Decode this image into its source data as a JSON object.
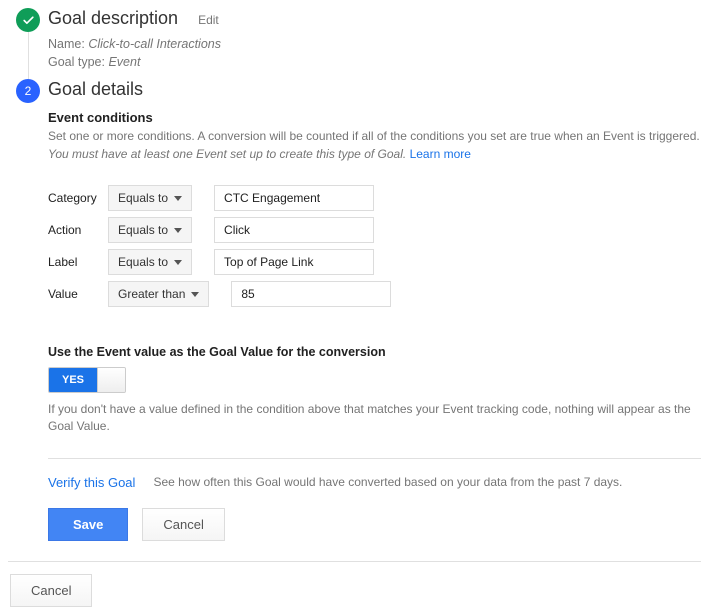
{
  "step1": {
    "title": "Goal description",
    "edit": "Edit",
    "name_label": "Name:",
    "name_value": "Click-to-call Interactions",
    "type_label": "Goal type:",
    "type_value": "Event"
  },
  "step2": {
    "title": "Goal details",
    "number": "2",
    "subheading": "Event conditions",
    "description_pre": "Set one or more conditions. A conversion will be counted if all of the conditions you set are true when an Event is triggered. ",
    "description_em": "You must have at least one Event set up to create this type of Goal.",
    "learn_more": "Learn more",
    "conditions": [
      {
        "label": "Category",
        "operator": "Equals to",
        "value": "CTC Engagement"
      },
      {
        "label": "Action",
        "operator": "Equals to",
        "value": "Click"
      },
      {
        "label": "Label",
        "operator": "Equals to",
        "value": "Top of Page Link"
      },
      {
        "label": "Value",
        "operator": "Greater than",
        "value": "85"
      }
    ],
    "use_value_label": "Use the Event value as the Goal Value for the conversion",
    "toggle_on": "YES",
    "use_value_help": "If you don't have a value defined in the condition above that matches your Event tracking code, nothing will appear as the Goal Value.",
    "verify_link": "Verify this Goal",
    "verify_desc": "See how often this Goal would have converted based on your data from the past 7 days.",
    "save": "Save",
    "cancel": "Cancel"
  },
  "outer_cancel": "Cancel"
}
